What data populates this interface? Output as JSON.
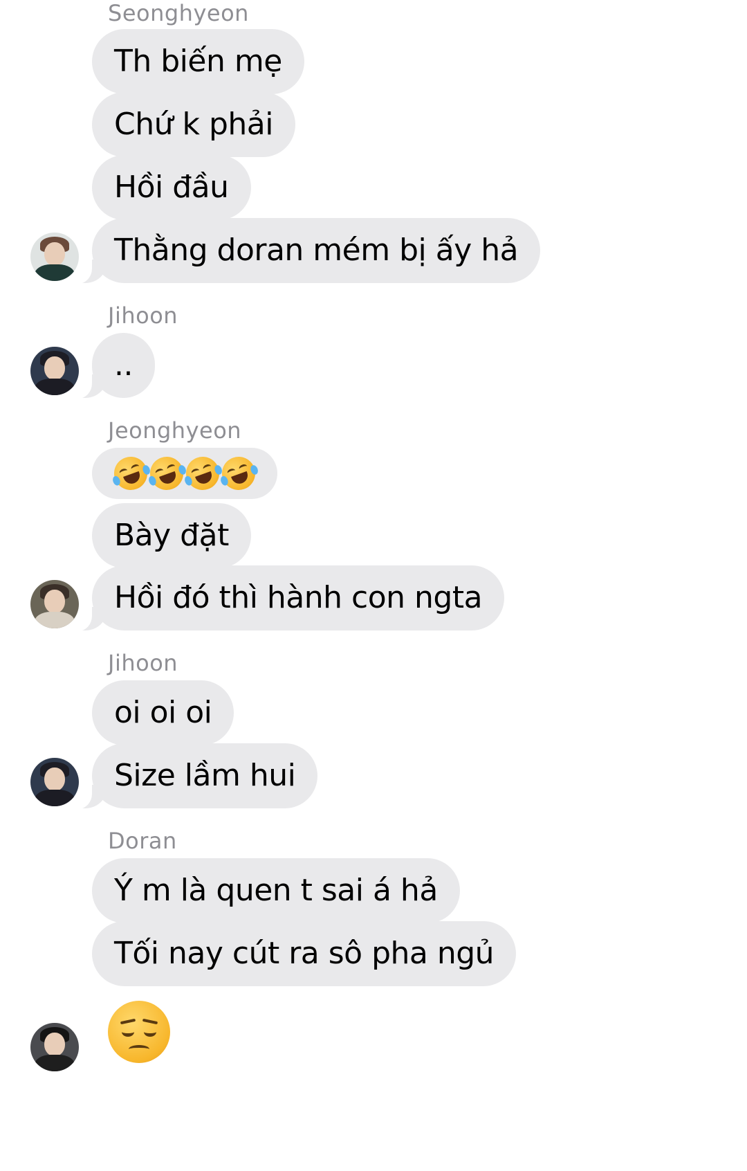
{
  "groups": [
    {
      "sender": "Seonghyeon",
      "messages": [
        "Th biến mẹ",
        "Chứ k phải",
        "Hồi đầu",
        "Thằng doran mém bị ấy hả"
      ],
      "avatar": "avatar-seonghyeon"
    },
    {
      "sender": "Jihoon",
      "messages": [
        ".."
      ],
      "avatar": "avatar-jihoon"
    },
    {
      "sender": "Jeonghyeon",
      "messages": [
        "rolling-on-floor-laughing x4",
        "Bày đặt",
        "Hồi đó thì hành con ngta"
      ],
      "avatar": "avatar-jeonghyeon"
    },
    {
      "sender": "Jihoon",
      "messages": [
        "oi oi oi",
        "Size lầm hui"
      ],
      "avatar": "avatar-jihoon"
    },
    {
      "sender": "Doran",
      "messages": [
        "Ý m là quen t sai á hả",
        "Tối nay cút ra sô pha ngủ",
        "unamused-face"
      ],
      "avatar": "avatar-doran"
    }
  ],
  "colors": {
    "bubble": "#e9e9eb",
    "sender_name": "#8e8e93",
    "text": "#000000"
  },
  "icons": {
    "laugh": "rolling-on-floor-laughing-emoji",
    "unamused": "unamused-face-emoji"
  }
}
